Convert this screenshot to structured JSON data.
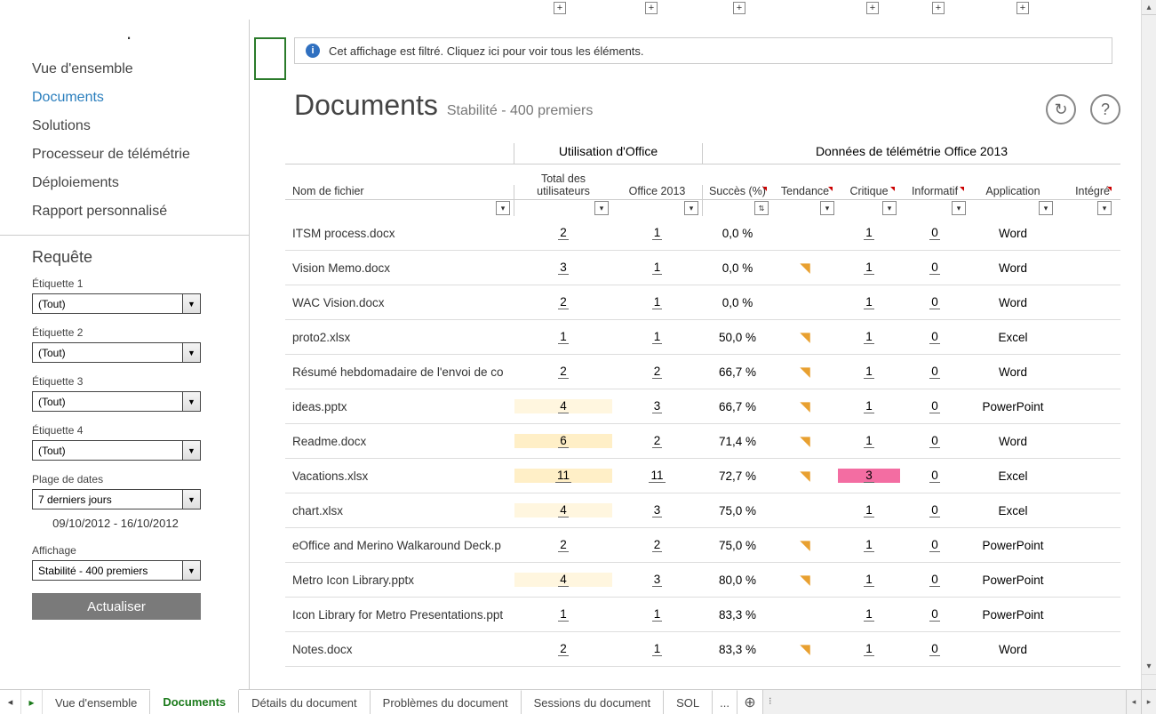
{
  "filter_bar": {
    "text": "Cet affichage est filtré. Cliquez ici pour voir tous les éléments."
  },
  "nav": {
    "items": [
      {
        "label": "Vue d'ensemble",
        "active": false
      },
      {
        "label": "Documents",
        "active": true
      },
      {
        "label": "Solutions",
        "active": false
      },
      {
        "label": "Processeur de télémétrie",
        "active": false
      },
      {
        "label": "Déploiements",
        "active": false
      },
      {
        "label": "Rapport personnalisé",
        "active": false
      }
    ]
  },
  "query": {
    "title": "Requête",
    "labels": {
      "et1": "Étiquette 1",
      "et2": "Étiquette 2",
      "et3": "Étiquette 3",
      "et4": "Étiquette 4",
      "date_range_label": "Plage de dates",
      "display_label": "Affichage"
    },
    "values": {
      "et1": "(Tout)",
      "et2": "(Tout)",
      "et3": "(Tout)",
      "et4": "(Tout)",
      "date_range": "7 derniers jours",
      "date_range_text": "09/10/2012 - 16/10/2012",
      "display": "Stabilité - 400 premiers"
    },
    "refresh": "Actualiser"
  },
  "page": {
    "title": "Documents",
    "subtitle": "Stabilité - 400 premiers"
  },
  "table": {
    "group_office": "Utilisation d'Office",
    "group_telemetry": "Données de télémétrie Office 2013",
    "headers": {
      "filename": "Nom de fichier",
      "total_users": "Total des utilisateurs",
      "office2013": "Office 2013",
      "success": "Succès (%)",
      "trend": "Tendance",
      "critical": "Critique",
      "informative": "Informatif",
      "application": "Application",
      "integrated": "Intégré"
    },
    "rows": [
      {
        "fn": "ITSM process.docx",
        "tu": "2",
        "o13": "1",
        "suc": "0,0 %",
        "trend": "",
        "crit": "1",
        "info": "0",
        "app": "Word"
      },
      {
        "fn": "Vision Memo.docx",
        "tu": "3",
        "o13": "1",
        "suc": "0,0 %",
        "trend": "down",
        "crit": "1",
        "info": "0",
        "app": "Word"
      },
      {
        "fn": "WAC Vision.docx",
        "tu": "2",
        "o13": "1",
        "suc": "0,0 %",
        "trend": "",
        "crit": "1",
        "info": "0",
        "app": "Word"
      },
      {
        "fn": "proto2.xlsx",
        "tu": "1",
        "o13": "1",
        "suc": "50,0 %",
        "trend": "down",
        "crit": "1",
        "info": "0",
        "app": "Excel"
      },
      {
        "fn": "Résumé hebdomadaire de l'envoi de co",
        "tu": "2",
        "o13": "2",
        "suc": "66,7 %",
        "trend": "down",
        "crit": "1",
        "info": "0",
        "app": "Word"
      },
      {
        "fn": "ideas.pptx",
        "tu": "4",
        "o13": "3",
        "suc": "66,7 %",
        "trend": "down",
        "crit": "1",
        "info": "0",
        "app": "PowerPoint",
        "tu_hl": "hl-warm"
      },
      {
        "fn": "Readme.docx",
        "tu": "6",
        "o13": "2",
        "suc": "71,4 %",
        "trend": "down",
        "crit": "1",
        "info": "0",
        "app": "Word",
        "tu_hl": "hl-warmer"
      },
      {
        "fn": "Vacations.xlsx",
        "tu": "11",
        "o13": "11",
        "suc": "72,7 %",
        "trend": "down",
        "crit": "3",
        "info": "0",
        "app": "Excel",
        "tu_hl": "hl-warmer",
        "crit_hl": "hl-pink"
      },
      {
        "fn": "chart.xlsx",
        "tu": "4",
        "o13": "3",
        "suc": "75,0 %",
        "trend": "",
        "crit": "1",
        "info": "0",
        "app": "Excel",
        "tu_hl": "hl-warm"
      },
      {
        "fn": "eOffice and Merino Walkaround Deck.p",
        "tu": "2",
        "o13": "2",
        "suc": "75,0 %",
        "trend": "down",
        "crit": "1",
        "info": "0",
        "app": "PowerPoint"
      },
      {
        "fn": "Metro Icon Library.pptx",
        "tu": "4",
        "o13": "3",
        "suc": "80,0 %",
        "trend": "down",
        "crit": "1",
        "info": "0",
        "app": "PowerPoint",
        "tu_hl": "hl-warm"
      },
      {
        "fn": "Icon Library for Metro Presentations.ppt",
        "tu": "1",
        "o13": "1",
        "suc": "83,3 %",
        "trend": "",
        "crit": "1",
        "info": "0",
        "app": "PowerPoint"
      },
      {
        "fn": "Notes.docx",
        "tu": "2",
        "o13": "1",
        "suc": "83,3 %",
        "trend": "down",
        "crit": "1",
        "info": "0",
        "app": "Word"
      }
    ]
  },
  "tabs": {
    "items": [
      {
        "label": "Vue d'ensemble",
        "active": false
      },
      {
        "label": "Documents",
        "active": true
      },
      {
        "label": "Détails du document",
        "active": false
      },
      {
        "label": "Problèmes du document",
        "active": false
      },
      {
        "label": "Sessions du document",
        "active": false
      },
      {
        "label": "SOL",
        "active": false
      }
    ],
    "more": "..."
  }
}
